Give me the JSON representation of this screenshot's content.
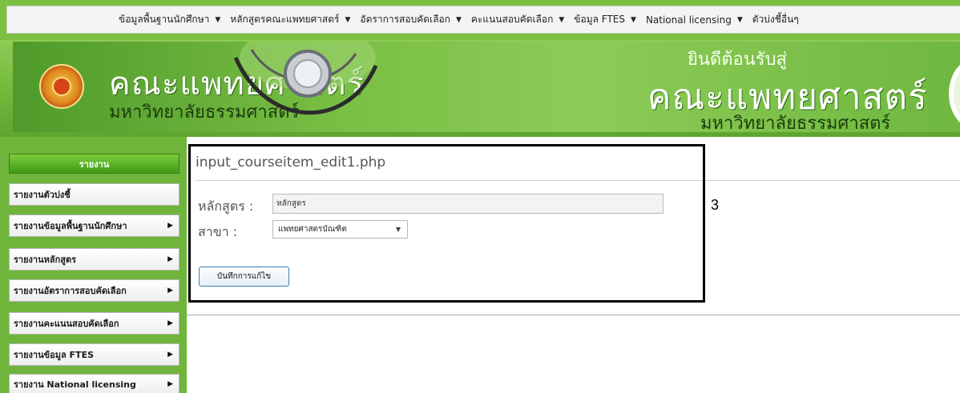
{
  "menu": {
    "items": [
      {
        "label": "ข้อมูลพื้นฐานนักศึกษา"
      },
      {
        "label": "หลักสูตรคณะแพทยศาสตร์"
      },
      {
        "label": "อัตราการสอบคัดเลือก"
      },
      {
        "label": "คะแนนสอบคัดเลือก"
      },
      {
        "label": "ข้อมูล FTES"
      },
      {
        "label": "National licensing"
      },
      {
        "label": "ตัวบ่งชี้อื่นๆ"
      }
    ],
    "caret": "▼"
  },
  "banner": {
    "title": "คณะแพทยศาสตร์",
    "subtitle": "มหาวิทยาลัยธรรมศาสตร์",
    "welcome": "ยินดีต้อนรับสู่",
    "welcome_title": "คณะแพทยศาสตร์",
    "welcome_subtitle": "มหาวิทยาลัยธรรมศาสตร์"
  },
  "sidebar": {
    "header": "รายงาน",
    "arrow": "▶",
    "items": [
      {
        "label": "รายงานตัวบ่งชี้",
        "has_arrow": false
      },
      {
        "label": "รายงานข้อมูลพื้นฐานนักศึกษา",
        "has_arrow": true
      },
      {
        "label": "รายงานหลักสูตร",
        "has_arrow": true
      },
      {
        "label": "รายงานอัตราการสอบคัดเลือก",
        "has_arrow": true
      },
      {
        "label": "รายงานคะแนนสอบคัดเลือก",
        "has_arrow": true
      },
      {
        "label": "รายงานข้อมูล FTES",
        "has_arrow": true
      },
      {
        "label": "รายงาน National licensing",
        "has_arrow": true
      }
    ]
  },
  "main": {
    "page_name": "input_courseitem_edit1.php",
    "course_label": "หลักสูตร :",
    "course_value": "หลักสูตร",
    "major_label": "สาขา :",
    "major_value": "แพทยศาสตรบัณฑิต",
    "major_caret": "▼",
    "save_button": "บันทึกการแก้ไข"
  },
  "annotation": {
    "number": "3",
    "color": "#000000"
  },
  "colors": {
    "brand_green": "#6fb53b",
    "header_green": "#3f9a16",
    "button_border": "#3c7fb1"
  }
}
